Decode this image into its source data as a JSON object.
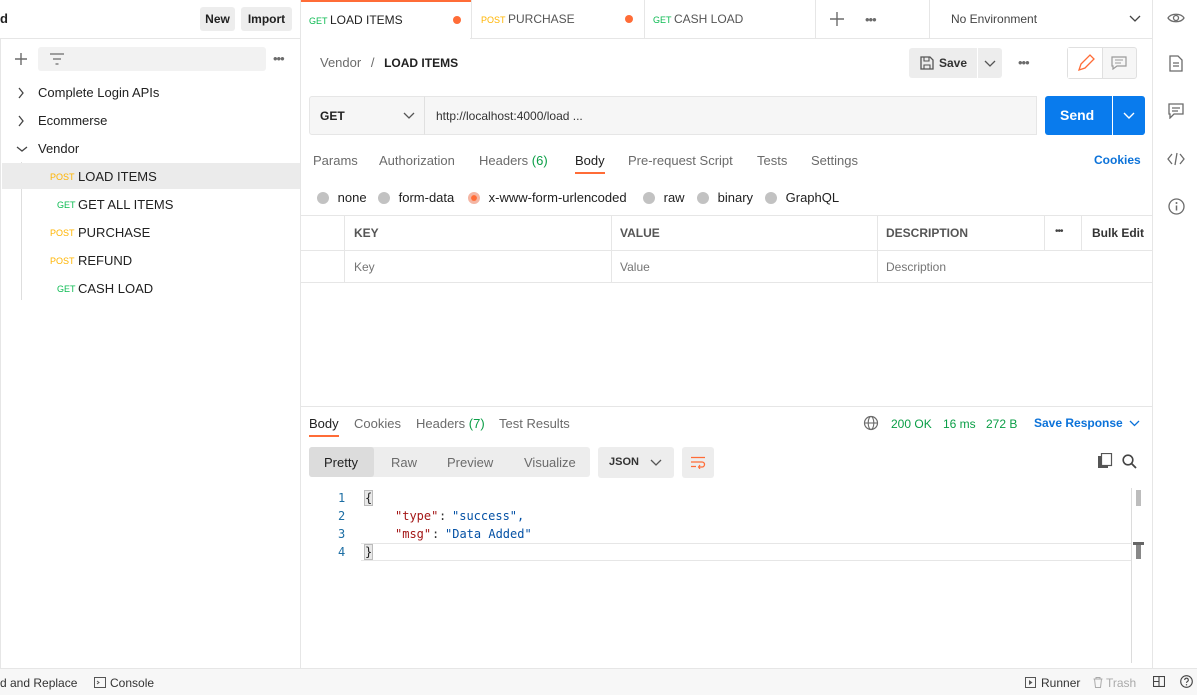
{
  "sidebar": {
    "header_fragment": "d",
    "new_label": "New",
    "import_label": "Import",
    "collections": [
      {
        "name": "Complete Login APIs"
      },
      {
        "name": "Ecommerse"
      },
      {
        "name": "Vendor"
      }
    ],
    "requests": [
      {
        "method": "POST",
        "name": "LOAD ITEMS"
      },
      {
        "method": "GET",
        "name": "GET ALL ITEMS"
      },
      {
        "method": "POST",
        "name": "PURCHASE"
      },
      {
        "method": "POST",
        "name": "REFUND"
      },
      {
        "method": "GET",
        "name": "CASH LOAD"
      }
    ]
  },
  "tabs": [
    {
      "method": "GET",
      "name": "LOAD ITEMS"
    },
    {
      "method": "POST",
      "name": "PURCHASE"
    },
    {
      "method": "GET",
      "name": "CASH LOAD"
    }
  ],
  "environment": "No Environment",
  "breadcrumb": {
    "parent": "Vendor",
    "separator": "/",
    "current": "LOAD ITEMS"
  },
  "save_label": "Save",
  "request": {
    "method": "GET",
    "url": "http://localhost:4000/load ...",
    "send_label": "Send"
  },
  "req_tabs": {
    "params": "Params",
    "authorization": "Authorization",
    "headers": "Headers",
    "headers_count": "(6)",
    "body": "Body",
    "prerequest": "Pre-request Script",
    "tests": "Tests",
    "settings": "Settings",
    "cookies": "Cookies"
  },
  "body_types": [
    "none",
    "form-data",
    "x-www-form-urlencoded",
    "raw",
    "binary",
    "GraphQL"
  ],
  "table": {
    "key_header": "KEY",
    "value_header": "VALUE",
    "description_header": "DESCRIPTION",
    "bulk_edit": "Bulk Edit",
    "key_placeholder": "Key",
    "value_placeholder": "Value",
    "description_placeholder": "Description"
  },
  "response": {
    "tabs": {
      "body": "Body",
      "cookies": "Cookies",
      "headers": "Headers",
      "headers_count": "(7)",
      "test_results": "Test Results"
    },
    "status": "200 OK",
    "time": "16 ms",
    "size": "272 B",
    "save_response": "Save Response",
    "views": [
      "Pretty",
      "Raw",
      "Preview",
      "Visualize"
    ],
    "format": "JSON",
    "code_lines": [
      {
        "num": "1",
        "text": "{"
      },
      {
        "num": "2",
        "key": "\"type\"",
        "value": "\"success\","
      },
      {
        "num": "3",
        "key": "\"msg\"",
        "value": "\"Data Added\""
      },
      {
        "num": "4",
        "text": "}"
      }
    ]
  },
  "footer": {
    "find_replace": "d and Replace",
    "console": "Console",
    "runner": "Runner",
    "trash": "Trash"
  },
  "colors": {
    "accent": "#ff6c37",
    "send_blue": "#097bed",
    "get_green": "#0cbb52",
    "post_yellow": "#ffb400"
  }
}
